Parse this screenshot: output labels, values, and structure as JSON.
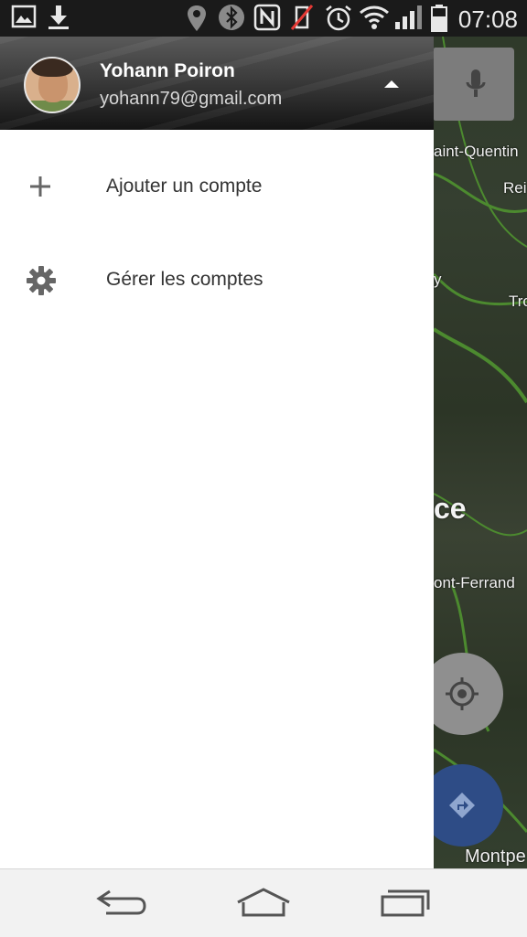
{
  "status_bar": {
    "time": "07:08",
    "icons": [
      "gallery-icon",
      "download-icon",
      "location-icon",
      "bluetooth-icon",
      "nfc-icon",
      "mute-icon",
      "alarm-icon",
      "wifi-icon",
      "signal-icon",
      "battery-icon"
    ]
  },
  "account": {
    "name": "Yohann Poiron",
    "email": "yohann79@gmail.com"
  },
  "menu": {
    "items": [
      {
        "label": "Ajouter un compte",
        "icon": "plus-icon"
      },
      {
        "label": "Gérer les comptes",
        "icon": "gear-icon"
      }
    ]
  },
  "map": {
    "labels": [
      "aint-Quentin",
      "Rei",
      "y",
      "Tro",
      "ce",
      "ont-Ferrand",
      "Montpe"
    ]
  },
  "nav_bar": {
    "buttons": [
      "back-icon",
      "home-icon",
      "recents-icon"
    ]
  },
  "colors": {
    "drawer_bg": "#ffffff",
    "nav_bg": "#f2f2f2",
    "directions_blue": "#2e4c86"
  }
}
